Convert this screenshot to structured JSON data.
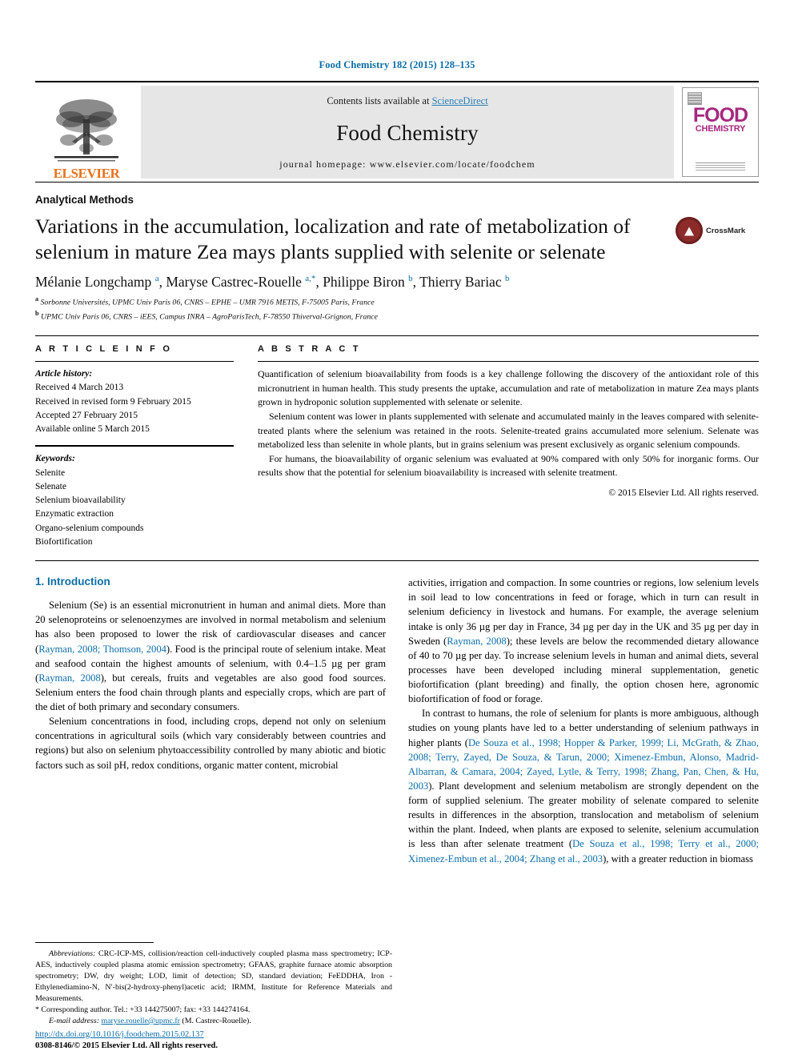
{
  "running_head": "Food Chemistry 182 (2015) 128–135",
  "masthead": {
    "contents_prefix": "Contents lists available at ",
    "sciencedirect": "ScienceDirect",
    "journal_title": "Food Chemistry",
    "homepage": "journal homepage: www.elsevier.com/locate/foodchem",
    "publisher": "ELSEVIER",
    "cover_line1": "FOOD",
    "cover_line2": "CHEMISTRY"
  },
  "article": {
    "section_category": "Analytical Methods",
    "title": "Variations in the accumulation, localization and rate of metabolization of selenium in mature Zea mays plants supplied with selenite or selenate",
    "crossmark_label": "CrossMark",
    "authors_html": "Mélanie Longchamp <sup>a</sup>, Maryse Castrec-Rouelle <sup>a,*</sup>, Philippe Biron <sup>b</sup>, Thierry Bariac <sup>b</sup>",
    "affiliation_a": "Sorbonne Universités, UPMC Univ Paris 06, CNRS – EPHE – UMR 7916 METIS, F-75005 Paris, France",
    "affiliation_b": "UPMC Univ Paris 06, CNRS – iEES, Campus INRA – AgroParisTech, F-78550 Thiverval-Grignon, France"
  },
  "article_info": {
    "heading": "A R T I C L E   I N F O",
    "history_label": "Article history:",
    "history": [
      "Received 4 March 2013",
      "Received in revised form 9 February 2015",
      "Accepted 27 February 2015",
      "Available online 5 March 2015"
    ],
    "keywords_label": "Keywords:",
    "keywords": [
      "Selenite",
      "Selenate",
      "Selenium bioavailability",
      "Enzymatic extraction",
      "Organo-selenium compounds",
      "Biofortification"
    ]
  },
  "abstract": {
    "heading": "A B S T R A C T",
    "paragraphs": [
      "Quantification of selenium bioavailability from foods is a key challenge following the discovery of the antioxidant role of this micronutrient in human health. This study presents the uptake, accumulation and rate of metabolization in mature Zea mays plants grown in hydroponic solution supplemented with selenate or selenite.",
      "Selenium content was lower in plants supplemented with selenate and accumulated mainly in the leaves compared with selenite-treated plants where the selenium was retained in the roots. Selenite-treated grains accumulated more selenium. Selenate was metabolized less than selenite in whole plants, but in grains selenium was present exclusively as organic selenium compounds.",
      "For humans, the bioavailability of organic selenium was evaluated at 90% compared with only 50% for inorganic forms. Our results show that the potential for selenium bioavailability is increased with selenite treatment."
    ],
    "copyright": "© 2015 Elsevier Ltd. All rights reserved."
  },
  "introduction": {
    "heading": "1. Introduction",
    "left_html": "<p>Selenium (Se) is an essential micronutrient in human and animal diets. More than 20 selenoproteins or selenoenzymes are involved in normal metabolism and selenium has also been proposed to lower the risk of cardiovascular diseases and cancer (<span class=\"ref\">Rayman, 2008; Thomson, 2004</span>). Food is the principal route of selenium intake. Meat and seafood contain the highest amounts of selenium, with 0.4–1.5 µg per gram (<span class=\"ref\">Rayman, 2008</span>), but cereals, fruits and vegetables are also good food sources. Selenium enters the food chain through plants and especially crops, which are part of the diet of both primary and secondary consumers.</p><p>Selenium concentrations in food, including crops, depend not only on selenium concentrations in agricultural soils (which vary considerably between countries and regions) but also on selenium phytoaccessibility controlled by many abiotic and biotic factors such as soil pH, redox conditions, organic matter content, microbial</p>",
    "right_html": "<p style=\"text-indent:0\">activities, irrigation and compaction. In some countries or regions, low selenium levels in soil lead to low concentrations in feed or forage, which in turn can result in selenium deficiency in livestock and humans. For example, the average selenium intake is only 36 µg per day in France, 34 µg per day in the UK and 35 µg per day in Sweden (<span class=\"ref\">Rayman, 2008</span>); these levels are below the recommended dietary allowance of 40 to 70 µg per day. To increase selenium levels in human and animal diets, several processes have been developed including mineral supplementation, genetic biofortification (plant breeding) and finally, the option chosen here, agronomic biofortification of food or forage.</p><p>In contrast to humans, the role of selenium for plants is more ambiguous, although studies on young plants have led to a better understanding of selenium pathways in higher plants (<span class=\"ref\">De Souza et al., 1998; Hopper &amp; Parker, 1999; Li, McGrath, &amp; Zhao, 2008; Terry, Zayed, De Souza, &amp; Tarun, 2000; Ximenez-Embun, Alonso, Madrid-Albarran, &amp; Camara, 2004; Zayed, Lytle, &amp; Terry, 1998; Zhang, Pan, Chen, &amp; Hu, 2003</span>). Plant development and selenium metabolism are strongly dependent on the form of supplied selenium. The greater mobility of selenate compared to selenite results in differences in the absorption, translocation and metabolism of selenium within the plant. Indeed, when plants are exposed to selenite, selenium accumulation is less than after selenate treatment (<span class=\"ref\">De Souza et al., 1998; Terry et al., 2000; Ximenez-Embun et al., 2004; Zhang et al., 2003</span>), with a greater reduction in biomass</p>"
  },
  "footnote": {
    "abbreviations_html": "<span class=\"it\">Abbreviations:</span> CRC-ICP-MS, collision/reaction cell-inductively coupled plasma mass spectrometry; ICP-AES, inductively coupled plasma atomic emission spectrometry; GFAAS, graphite furnace atomic absorption spectrometry; DW, dry weight; LOD, limit of detection; SD, standard deviation; FeEDDHA, Iron - Ethylenediamino-N, N′-bis(2-hydroxy-phenyl)acetic acid; IRMM, Institute for Reference Materials and Measurements.",
    "corresponding": "* Corresponding author. Tel.: +33 144275007; fax: +33 144274164.",
    "email_label": "E-mail address:",
    "email": "maryse.rouelle@upmc.fr",
    "email_owner": "(M. Castrec-Rouelle)."
  },
  "footer": {
    "doi": "http://dx.doi.org/10.1016/j.foodchem.2015.02.137",
    "issn_line": "0308-8146/© 2015 Elsevier Ltd. All rights reserved."
  }
}
